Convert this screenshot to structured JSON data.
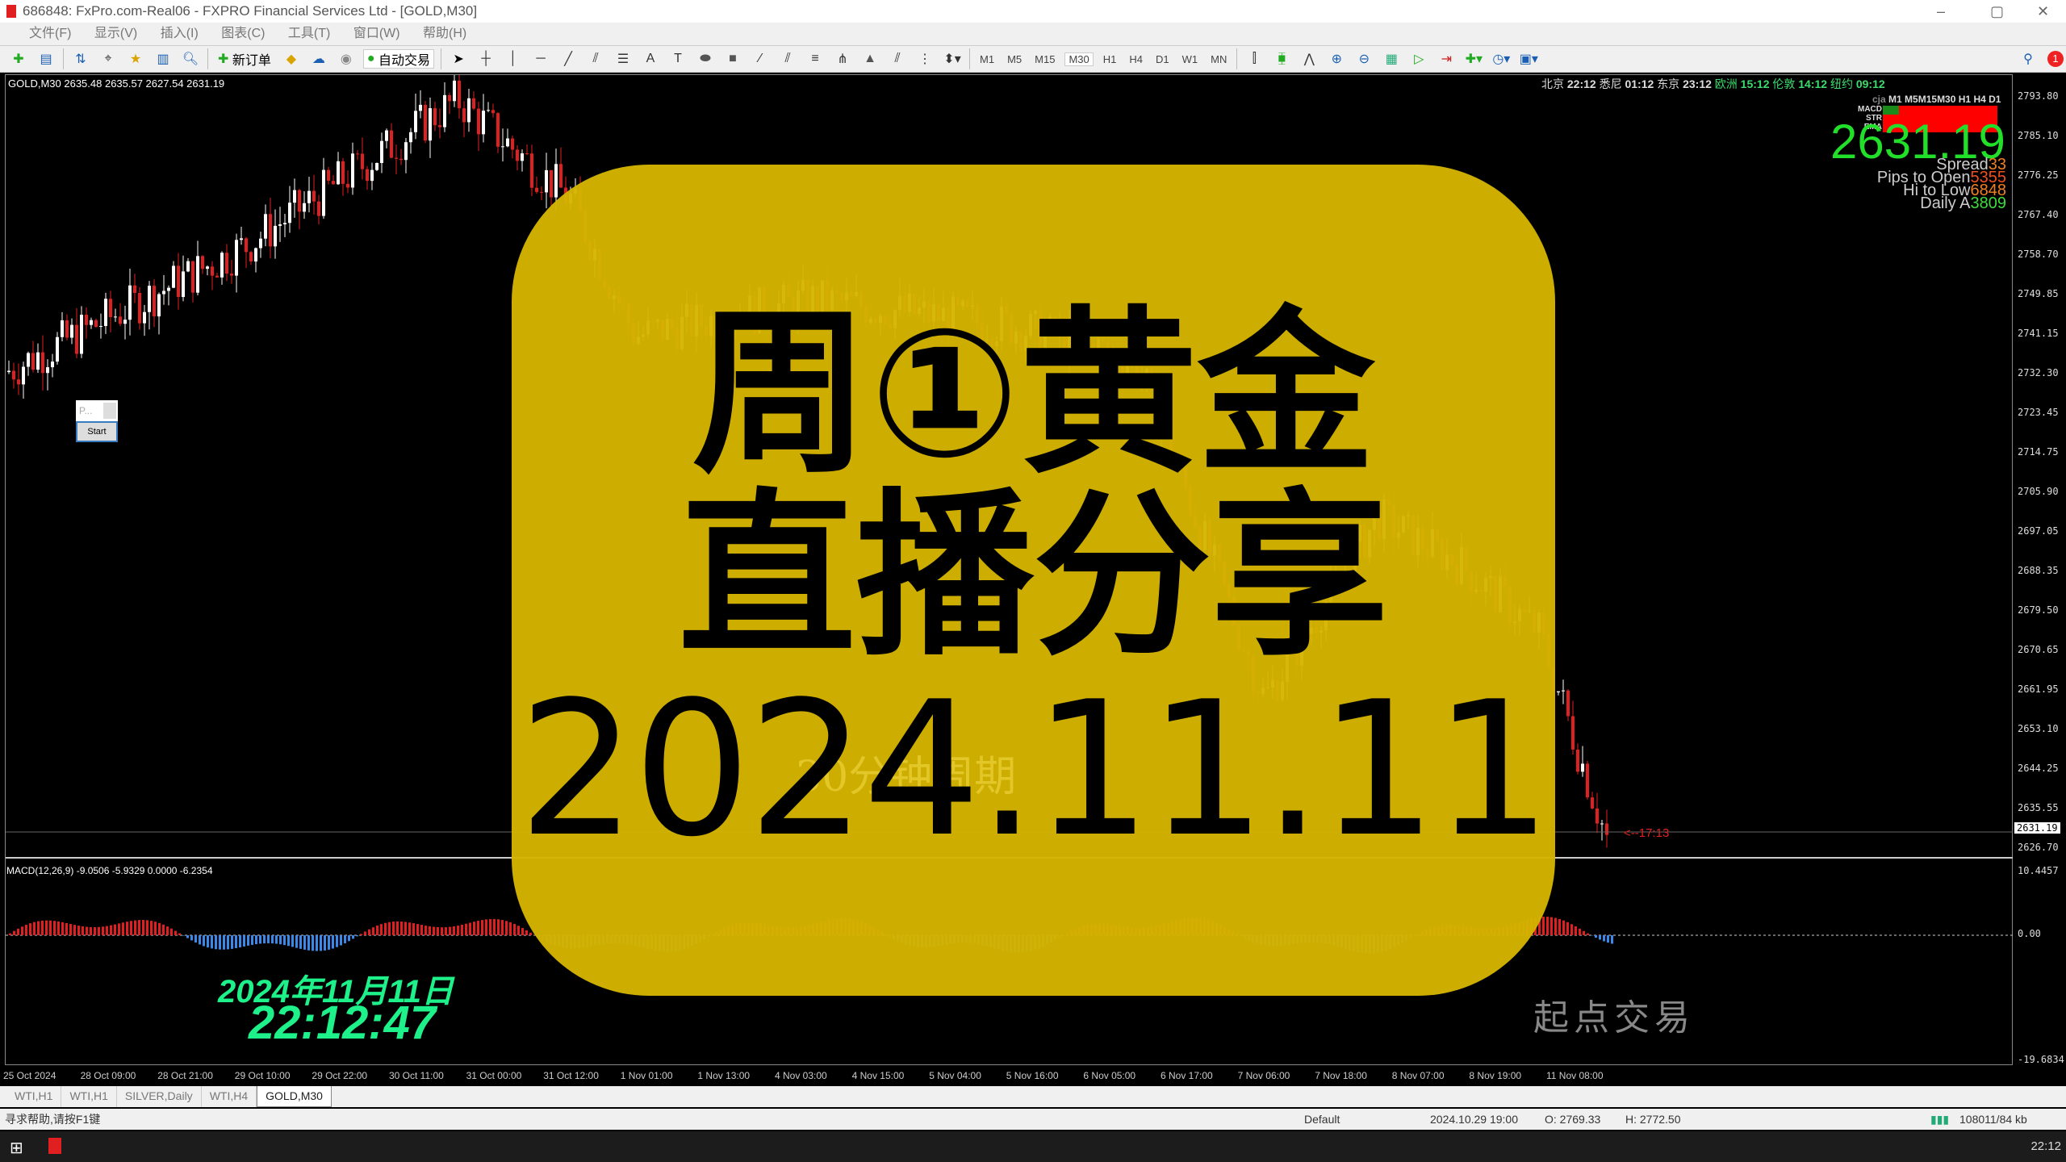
{
  "window": {
    "title": "686848: FxPro.com-Real06 - FXPRO Financial Services Ltd - [GOLD,M30]"
  },
  "menu": [
    "文件(F)",
    "显示(V)",
    "插入(I)",
    "图表(C)",
    "工具(T)",
    "窗口(W)",
    "帮助(H)"
  ],
  "toolbar": {
    "new_order": "新订单",
    "auto_trading": "自动交易",
    "timeframes": [
      "M1",
      "M5",
      "M15",
      "M30",
      "H1",
      "H4",
      "D1",
      "W1",
      "MN"
    ],
    "active_timeframe": "M30",
    "notification_count": "1"
  },
  "chart": {
    "ohlc_label": "GOLD,M30  2635.48 2635.57 2627.54 2631.19",
    "clocks": [
      {
        "city": "北京",
        "time": "22:12"
      },
      {
        "city": "悉尼",
        "time": "01:12"
      },
      {
        "city": "东京",
        "time": "23:12"
      },
      {
        "city": "欧洲",
        "time": "15:12"
      },
      {
        "city": "伦敦",
        "time": "14:12"
      },
      {
        "city": "纽约",
        "time": "09:12"
      }
    ],
    "indicator_panel": {
      "header": [
        "cja",
        "M1",
        "M5",
        "M15",
        "M30",
        "H1",
        "H4",
        "D1"
      ],
      "rows": [
        "MACD",
        "STR",
        "EMA"
      ]
    },
    "current_price": "2631.19",
    "stats": [
      {
        "label": "Spread",
        "value": "33",
        "color": "#f08020"
      },
      {
        "label": "Pips to Open",
        "value": "5355",
        "color": "#f05020"
      },
      {
        "label": "Hi to Low",
        "value": "6848",
        "color": "#f08020"
      },
      {
        "label": "Daily A",
        "value": "3809",
        "color": "#3ddc3d"
      }
    ],
    "price_axis": [
      "2793.80",
      "2785.10",
      "2776.25",
      "2767.40",
      "2758.70",
      "2749.85",
      "2741.15",
      "2732.30",
      "2723.45",
      "2714.75",
      "2705.90",
      "2697.05",
      "2688.35",
      "2679.50",
      "2670.65",
      "2661.95",
      "2653.10",
      "2644.25",
      "2635.55",
      "2626.70"
    ],
    "price_marker": "2631.19",
    "countdown": "<--17:13",
    "panel": {
      "field_placeholder": "P...",
      "start_label": "Start"
    },
    "overlay": {
      "line1": "周①黄金",
      "line2": "直播分享",
      "line3": "2024.11.11",
      "watermark": "30分钟周期",
      "color": "#d4b400"
    },
    "macd": {
      "label": "MACD(12,26,9) -9.0506 -5.9329 0.0000 -6.2354",
      "axis": [
        "10.4457",
        "0.00",
        "-19.6834"
      ]
    },
    "date_stamp": "2024年11月11日",
    "time_stamp": "22:12:47",
    "brand": "起点交易",
    "time_axis": [
      "25 Oct 2024",
      "28 Oct 09:00",
      "28 Oct 21:00",
      "29 Oct 10:00",
      "29 Oct 22:00",
      "30 Oct 11:00",
      "31 Oct 00:00",
      "31 Oct 12:00",
      "1 Nov 01:00",
      "1 Nov 13:00",
      "4 Nov 03:00",
      "4 Nov 15:00",
      "5 Nov 04:00",
      "5 Nov 16:00",
      "6 Nov 05:00",
      "6 Nov 17:00",
      "7 Nov 06:00",
      "7 Nov 18:00",
      "8 Nov 07:00",
      "8 Nov 19:00",
      "11 Nov 08:00"
    ]
  },
  "tabs": [
    {
      "label": "WTI,H1"
    },
    {
      "label": "WTI,H1"
    },
    {
      "label": "SILVER,Daily"
    },
    {
      "label": "WTI,H4"
    },
    {
      "label": "GOLD,M30",
      "active": true
    }
  ],
  "status": {
    "help": "寻求帮助,请按F1键",
    "profile": "Default",
    "date": "2024.10.29 19:00",
    "open": "O: 2769.33",
    "high": "H: 2772.50",
    "traffic": "108011/84 kb"
  },
  "taskbar": {
    "time": "22:12"
  }
}
